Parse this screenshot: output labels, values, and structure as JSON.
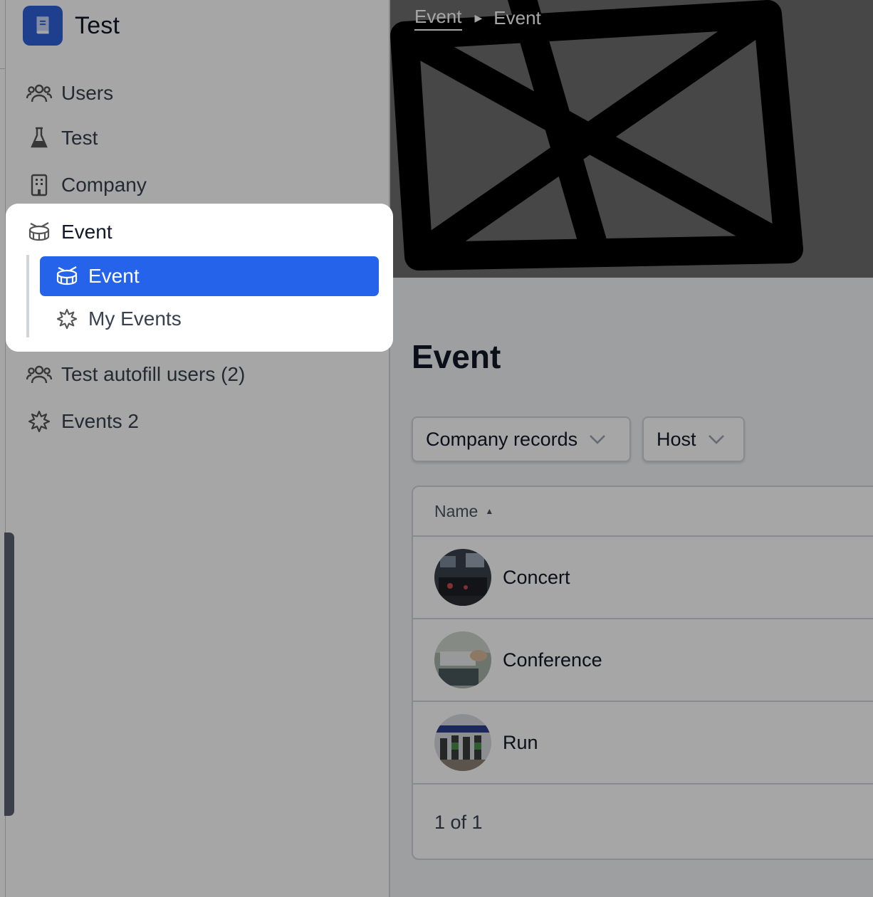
{
  "app": {
    "title": "Test",
    "logo_icon": "book-icon",
    "accent": "#2563eb"
  },
  "sidebar": {
    "items": [
      {
        "label": "Users",
        "icon": "users-icon"
      },
      {
        "label": "Test",
        "icon": "flask-icon"
      },
      {
        "label": "Company",
        "icon": "building-icon"
      },
      {
        "label": "Event",
        "icon": "drum-icon"
      },
      {
        "label": "Test autofill users (2)",
        "icon": "users-icon"
      },
      {
        "label": "Events 2",
        "icon": "burst-icon"
      }
    ],
    "subitems": [
      {
        "label": "Event",
        "icon": "drum-icon",
        "active": true
      },
      {
        "label": "My Events",
        "icon": "burst-icon",
        "active": false
      }
    ]
  },
  "breadcrumb": {
    "parent": "Event",
    "current": "Event"
  },
  "page": {
    "title": "Event"
  },
  "filters": {
    "company": "Company records",
    "host": "Host"
  },
  "table": {
    "columns": [
      "Name"
    ],
    "sort": "ascending",
    "rows": [
      {
        "name": "Concert"
      },
      {
        "name": "Conference"
      },
      {
        "name": "Run"
      }
    ],
    "pagination": "1 of 1"
  }
}
